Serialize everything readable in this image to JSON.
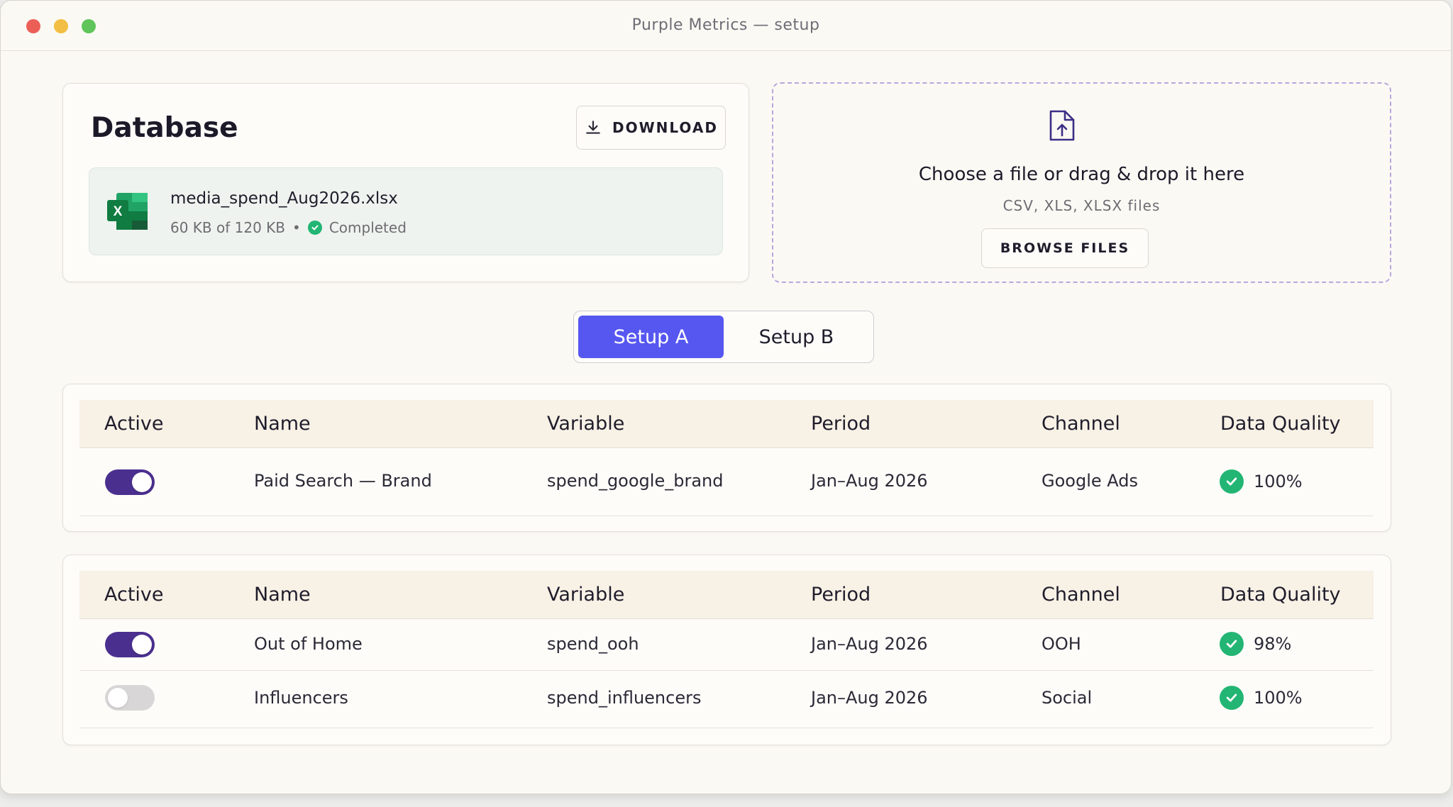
{
  "window": {
    "title": "Purple Metrics — setup"
  },
  "database": {
    "title": "Database",
    "download_label": "DOWNLOAD",
    "file": {
      "name": "media_spend_Aug2026.xlsx",
      "size": "60 KB of 120 KB",
      "separator": "•",
      "status": "Completed",
      "icon": "excel-icon"
    }
  },
  "upload": {
    "icon": "file-upload-icon",
    "title": "Choose a file or drag & drop it here",
    "subtitle": "CSV, XLS, XLSX files",
    "browse_label": "BROWSE FILES"
  },
  "tabs": {
    "items": [
      "Setup A",
      "Setup B"
    ],
    "selected": "Setup A",
    "accent": "#5657f0"
  },
  "columns": [
    "Active",
    "Name",
    "Variable",
    "Period",
    "Channel",
    "Data Quality"
  ],
  "tables": [
    {
      "rows": [
        {
          "active": true,
          "name": "Paid Search — Brand",
          "variable": "spend_google_brand",
          "period": "Jan–Aug 2026",
          "channel": "Google Ads",
          "quality": "100%"
        }
      ]
    },
    {
      "rows": [
        {
          "active": true,
          "name": "Out of Home",
          "variable": "spend_ooh",
          "period": "Jan–Aug 2026",
          "channel": "OOH",
          "quality": "98%"
        },
        {
          "active": false,
          "name": "Influencers",
          "variable": "spend_influencers",
          "period": "Jan–Aug 2026",
          "channel": "Social",
          "quality": "100%"
        }
      ]
    }
  ],
  "colors": {
    "toggle_on": "#4b2f8f",
    "toggle_off": "#d8d6d6",
    "quality_ok": "#22b573",
    "dropzone_border": "#b7a8dd"
  }
}
